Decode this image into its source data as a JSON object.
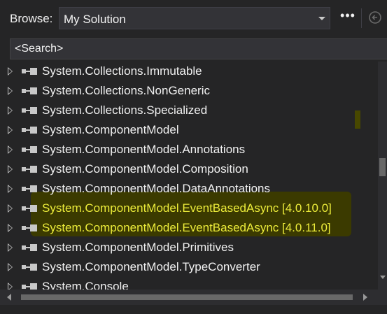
{
  "toolbar": {
    "browse_label": "Browse:",
    "browse_value": "My Solution",
    "more_label": "•••"
  },
  "search": {
    "placeholder": "<Search>"
  },
  "tree": {
    "items": [
      {
        "label": "System.Collections.Immutable",
        "highlighted": false
      },
      {
        "label": "System.Collections.NonGeneric",
        "highlighted": false
      },
      {
        "label": "System.Collections.Specialized",
        "highlighted": false
      },
      {
        "label": "System.ComponentModel",
        "highlighted": false
      },
      {
        "label": "System.ComponentModel.Annotations",
        "highlighted": false
      },
      {
        "label": "System.ComponentModel.Composition",
        "highlighted": false
      },
      {
        "label": "System.ComponentModel.DataAnnotations",
        "highlighted": false
      },
      {
        "label": "System.ComponentModel.EventBasedAsync [4.0.10.0]",
        "highlighted": true
      },
      {
        "label": "System.ComponentModel.EventBasedAsync [4.0.11.0]",
        "highlighted": true
      },
      {
        "label": "System.ComponentModel.Primitives",
        "highlighted": false
      },
      {
        "label": "System.ComponentModel.TypeConverter",
        "highlighted": false
      },
      {
        "label": "System.Console",
        "highlighted": false
      }
    ]
  },
  "colors": {
    "background": "#252526",
    "text": "#f1f1f1",
    "highlight_text": "#ecec3a",
    "highlight_back": "#3b3a00"
  }
}
